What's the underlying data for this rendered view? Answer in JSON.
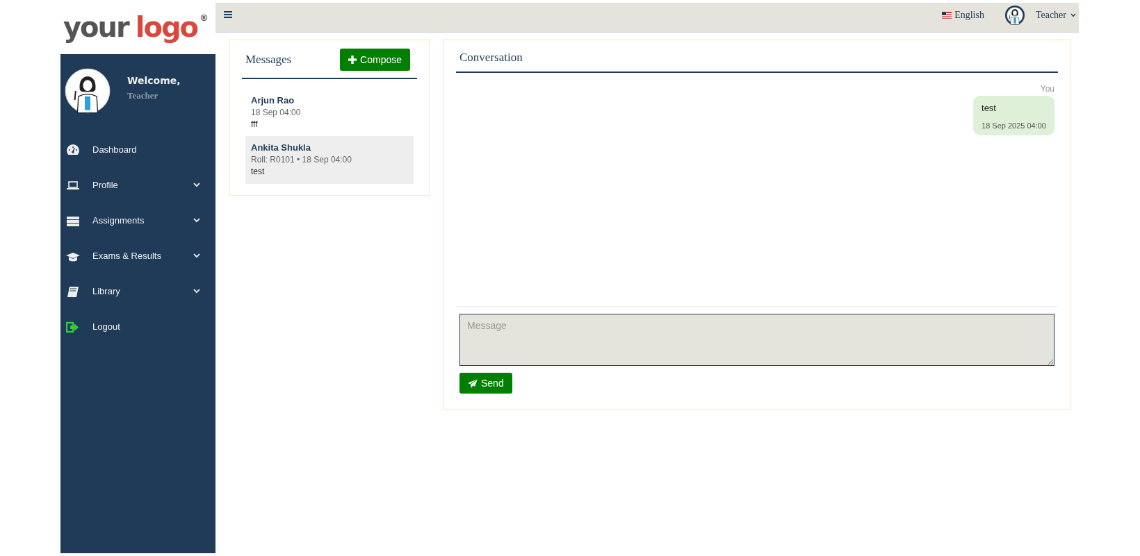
{
  "logo": {
    "word_1": "your",
    "word_2": "logo",
    "mark": "®"
  },
  "sidebar": {
    "welcome": "Welcome,",
    "role": "Teacher",
    "items": [
      {
        "label": "Dashboard",
        "has_submenu": false
      },
      {
        "label": "Profile",
        "has_submenu": true
      },
      {
        "label": "Assignments",
        "has_submenu": true
      },
      {
        "label": "Exams & Results",
        "has_submenu": true
      },
      {
        "label": "Library",
        "has_submenu": true
      },
      {
        "label": "Logout",
        "has_submenu": false
      }
    ]
  },
  "topbar": {
    "language": "English",
    "user": "Teacher"
  },
  "messages": {
    "title": "Messages",
    "compose": "Compose",
    "threads": [
      {
        "name": "Arjun Rao",
        "meta": "18 Sep 04:00",
        "preview": "fff",
        "selected": false
      },
      {
        "name": "Ankita Shukla",
        "meta": "Roll: R0101 • 18 Sep 04:00",
        "preview": "test",
        "selected": true
      }
    ]
  },
  "conversation": {
    "title": "Conversation",
    "messages": [
      {
        "sender": "You",
        "text": "test",
        "time": "18 Sep 2025 04:00"
      }
    ],
    "input": {
      "placeholder": "Message"
    },
    "send": "Send"
  }
}
